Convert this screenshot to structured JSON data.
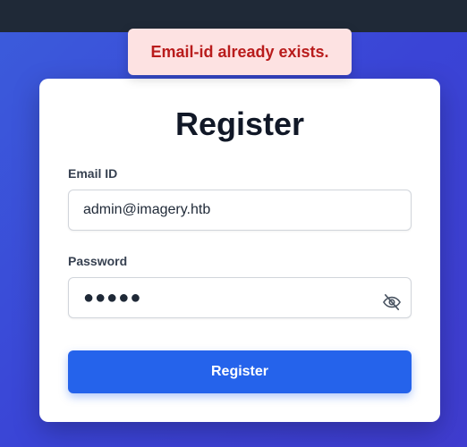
{
  "toast": {
    "message": "Email-id already exists."
  },
  "form": {
    "title": "Register",
    "email": {
      "label": "Email ID",
      "value": "admin@imagery.htb"
    },
    "password": {
      "label": "Password",
      "masked_value": "●●●●●"
    },
    "submit_label": "Register"
  },
  "colors": {
    "topbar": "#1f2937",
    "background": "#3b3fd8",
    "accent": "#2563eb",
    "toast_bg": "#fde2e2",
    "toast_text": "#b91c1c"
  },
  "icons": {
    "password_toggle": "eye-off-icon"
  }
}
